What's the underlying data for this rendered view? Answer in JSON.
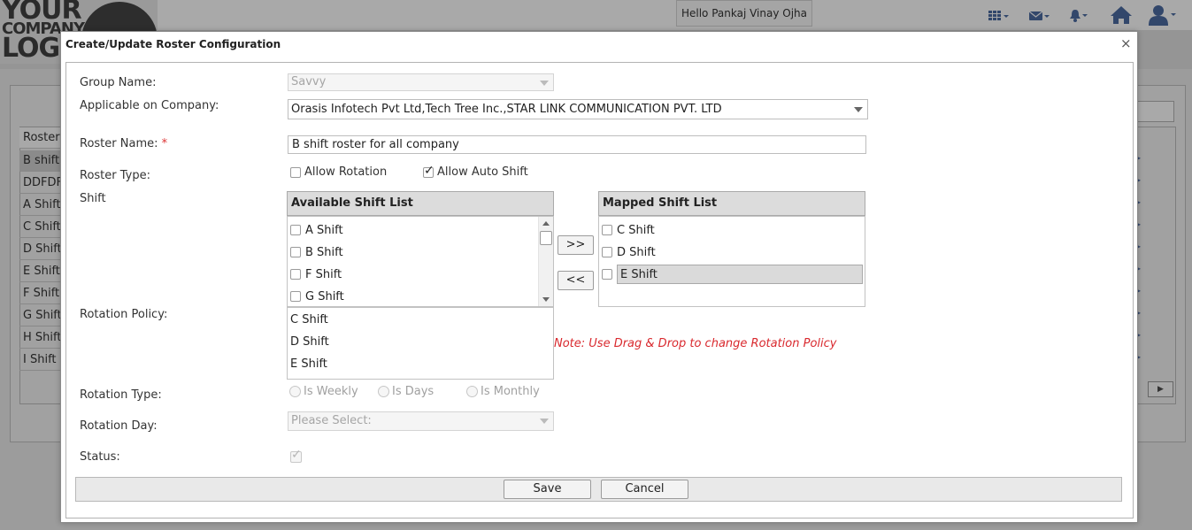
{
  "app": {
    "logo_text_1": "YOUR",
    "logo_text_2": "COMPANY",
    "logo_text_3": "LOG",
    "greeting": "Hello Pankaj Vinay Ojha",
    "icons": [
      "grid-icon",
      "mail-icon",
      "bell-icon",
      "home-icon",
      "user-icon"
    ],
    "accent_color": "#32476b"
  },
  "background_table": {
    "header": "Roster",
    "rows": [
      "B shift",
      "DDFDF",
      "A Shift",
      "C Shift",
      "D Shift",
      "E Shift",
      "F Shift",
      "G Shift",
      "H Shift",
      "I Shift"
    ]
  },
  "modal": {
    "title": "Create/Update Roster Configuration",
    "close_symbol": "×",
    "labels": {
      "group_name": "Group Name:",
      "applicable_company": "Applicable on Company:",
      "roster_name": "Roster Name:",
      "required_mark": "*",
      "roster_type": "Roster Type:",
      "shift": "Shift",
      "rotation_policy": "Rotation Policy:",
      "rotation_type": "Rotation Type:",
      "rotation_day": "Rotation Day:",
      "status": "Status:"
    },
    "group_name_value": "Savvy",
    "company_value": "Orasis Infotech Pvt Ltd,Tech Tree Inc.,STAR LINK COMMUNICATION PVT. LTD",
    "roster_name_value": "B shift roster for all company",
    "roster_type": {
      "allow_rotation": {
        "label": "Allow Rotation",
        "checked": false
      },
      "allow_auto_shift": {
        "label": "Allow Auto Shift",
        "checked": true
      }
    },
    "available_shift_list": {
      "title": "Available Shift List",
      "items": [
        "A Shift",
        "B Shift",
        "F Shift",
        "G Shift"
      ]
    },
    "move_right_label": ">>",
    "move_left_label": "<<",
    "mapped_shift_list": {
      "title": "Mapped Shift List",
      "items": [
        "C Shift",
        "D Shift",
        "E Shift"
      ],
      "selected": "E Shift"
    },
    "rotation_policy_items": [
      "C Shift",
      "D Shift",
      "E Shift"
    ],
    "rotation_note": "Note: Use Drag & Drop to change Rotation Policy",
    "rotation_type_options": [
      "Is Weekly",
      "Is Days",
      "Is Monthly"
    ],
    "rotation_day_value": "Please Select:",
    "status_checked": true,
    "save_label": "Save",
    "cancel_label": "Cancel"
  }
}
